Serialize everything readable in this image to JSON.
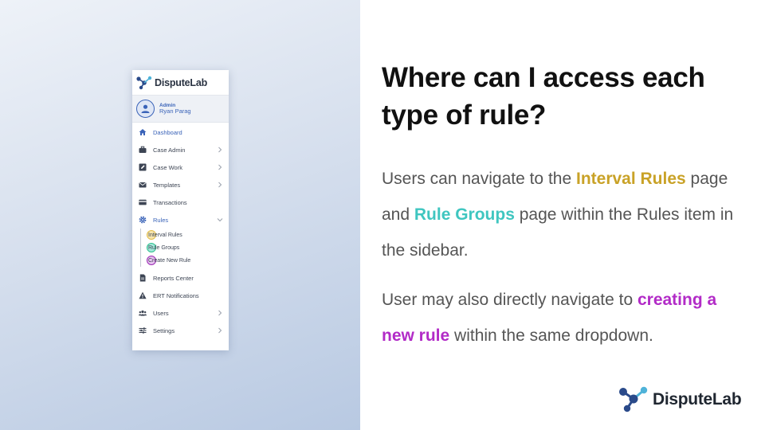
{
  "slide": {
    "heading": "Where can I access each type of rule?",
    "p1": {
      "t1": "Users can navigate to the ",
      "interval_rules": "Interval Rules",
      "t2": " page and ",
      "rule_groups": "Rule Groups",
      "t3": " page within the Rules item in the sidebar."
    },
    "p2": {
      "t1": "User may also directly navigate to ",
      "create_rule": "creating a new rule",
      "t2": " within the same dropdown."
    },
    "brand": "DisputeLab"
  },
  "sidebar": {
    "logo": "DisputeLab",
    "user_role": "Admin",
    "user_name": "Ryan Parag",
    "items": [
      {
        "label": "Dashboard",
        "icon": "home-icon"
      },
      {
        "label": "Case Admin",
        "icon": "briefcase-icon"
      },
      {
        "label": "Case Work",
        "icon": "edit-icon"
      },
      {
        "label": "Templates",
        "icon": "envelope-icon"
      },
      {
        "label": "Transactions",
        "icon": "credit-card-icon"
      },
      {
        "label": "Rules",
        "icon": "gear-icon"
      },
      {
        "label": "Reports Center",
        "icon": "document-icon"
      },
      {
        "label": "ERT Notifications",
        "icon": "warning-icon"
      },
      {
        "label": "Users",
        "icon": "users-icon"
      },
      {
        "label": "Settings",
        "icon": "sliders-icon"
      }
    ],
    "rules_sub": [
      {
        "label": "Interval Rules"
      },
      {
        "label": "Rule Groups"
      },
      {
        "label": "Create New Rule"
      }
    ]
  },
  "colors": {
    "accent_blue": "#3a63b8",
    "gold": "#c9a227",
    "teal": "#3fc6c0",
    "purple": "#b22bc7"
  }
}
